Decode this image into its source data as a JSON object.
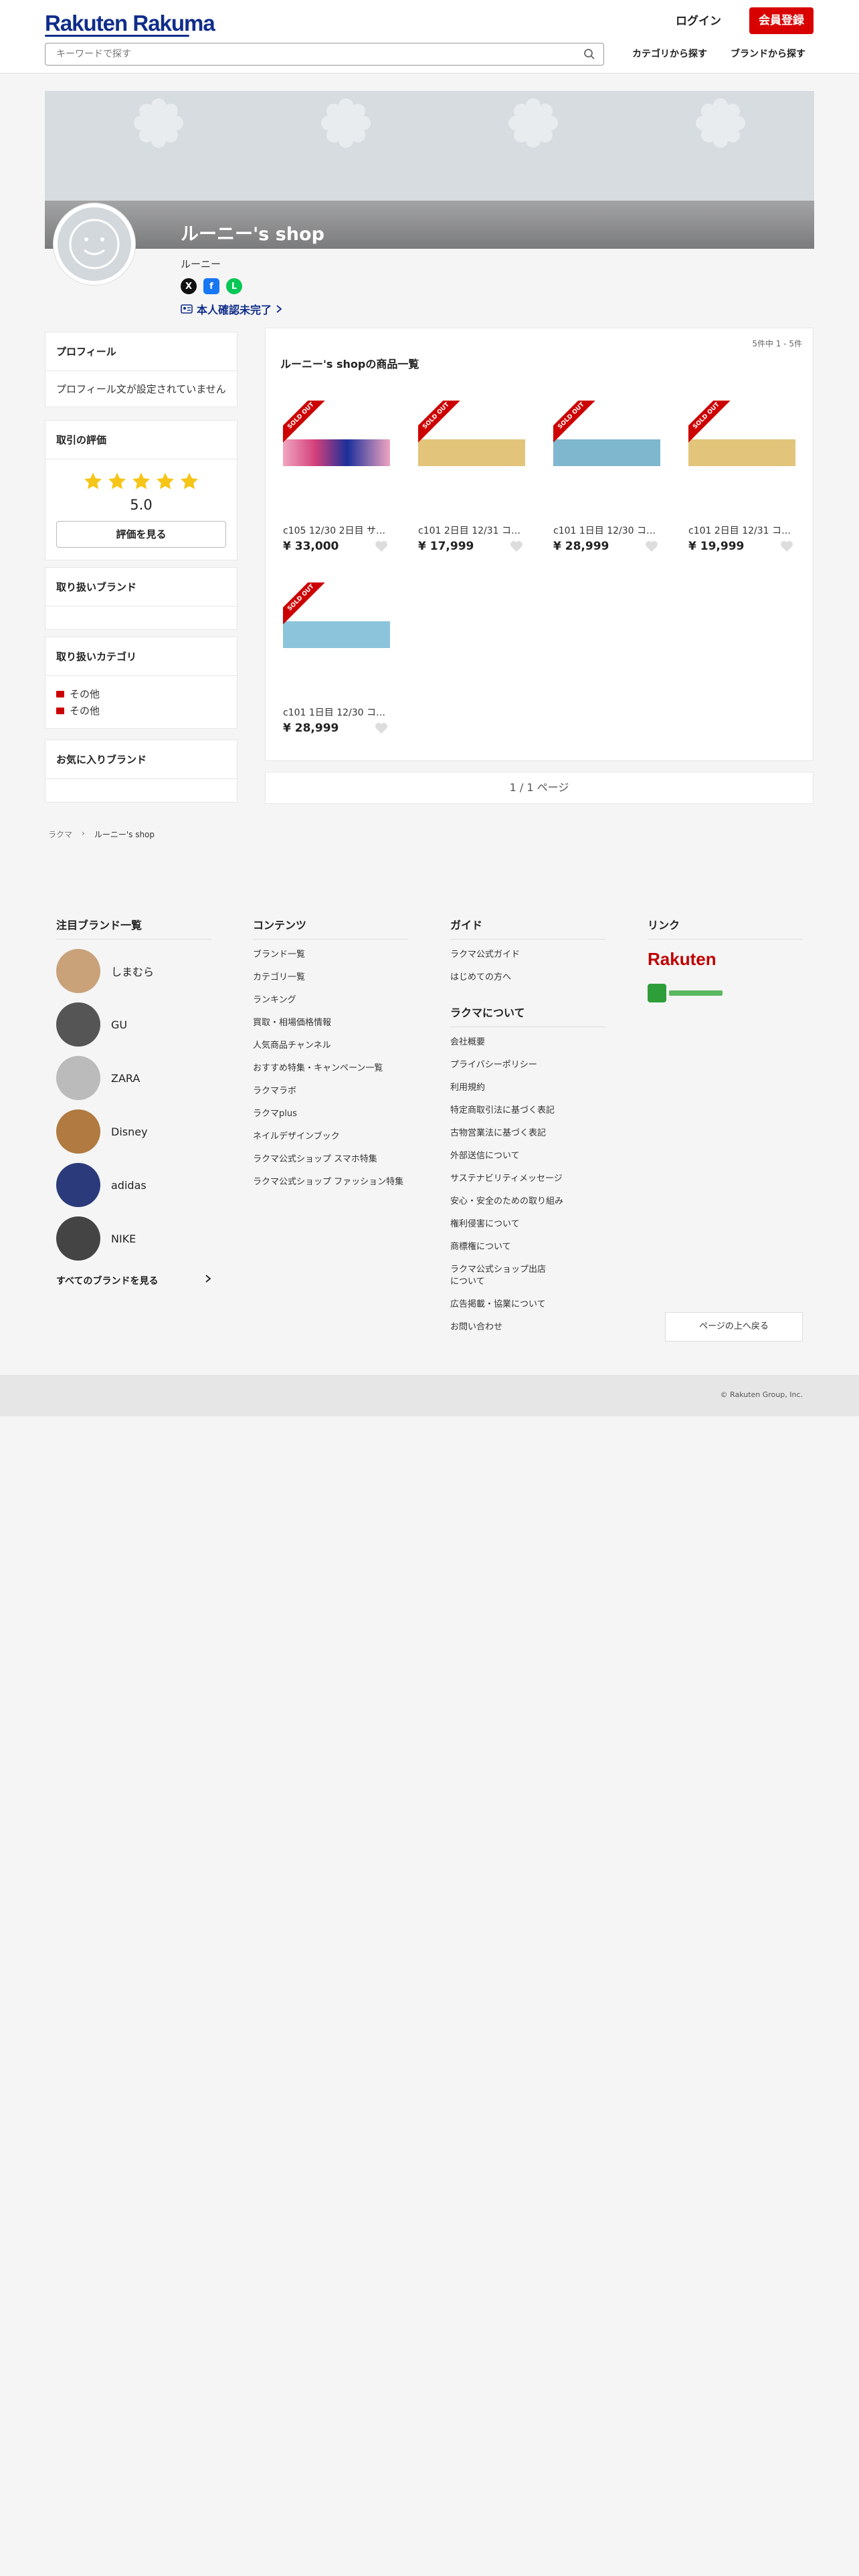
{
  "header": {
    "logo": "Rakuten Rakuma",
    "login": "ログイン",
    "signup": "会員登録",
    "search_placeholder": "キーワードで探す",
    "nav_category": "カテゴリから探す",
    "nav_brand": "ブランドから探す"
  },
  "shop": {
    "title": "ルーニー's shop",
    "username": "ルーニー",
    "verification": "本人確認未完了"
  },
  "sidebar": {
    "profile": {
      "title": "プロフィール",
      "text": "プロフィール文が設定されていません"
    },
    "rating": {
      "title": "取引の評価",
      "stars": 5,
      "score": "5.0",
      "button": "評価を見る"
    },
    "brands": {
      "title": "取り扱いブランド"
    },
    "categories": {
      "title": "取り扱いカテゴリ",
      "items": [
        "その他",
        "その他"
      ]
    },
    "favorite_brands": {
      "title": "お気に入りブランド"
    }
  },
  "listing": {
    "count": "5件中 1 - 5件",
    "title": "ルーニー's shopの商品一覧",
    "sold_label": "SOLD OUT",
    "items": [
      {
        "name": "c105 12/30 2日目 サ…",
        "price": "¥ 33,000",
        "ticket_color": "#d4407a"
      },
      {
        "name": "c101 2日目 12/31 コ…",
        "price": "¥ 17,999",
        "ticket_color": "#e2c47a"
      },
      {
        "name": "c101 1日目 12/30 コ…",
        "price": "¥ 28,999",
        "ticket_color": "#7fb7cf"
      },
      {
        "name": "c101 2日目 12/31 コ…",
        "price": "¥ 19,999",
        "ticket_color": "#e2c47a"
      },
      {
        "name": "c101 1日目 12/30 コ…",
        "price": "¥ 28,999",
        "ticket_color": "#8cc4dc"
      }
    ],
    "pager": "1 / 1 ページ"
  },
  "breadcrumb": {
    "home": "ラクマ",
    "current": "ルーニー's shop"
  },
  "footer": {
    "brands_title": "注目ブランド一覧",
    "brands": [
      "しまむら",
      "GU",
      "ZARA",
      "Disney",
      "adidas",
      "NIKE"
    ],
    "all_brands": "すべてのブランドを見る",
    "contents_title": "コンテンツ",
    "contents": [
      "ブランド一覧",
      "カテゴリ一覧",
      "ランキング",
      "買取・相場価格情報",
      "人気商品チャンネル",
      "おすすめ特集・キャンペーン一覧",
      "ラクマラボ",
      "ラクマplus",
      "ネイルデザインブック",
      "ラクマ公式ショップ スマホ特集",
      "ラクマ公式ショップ ファッション特集"
    ],
    "guide_title": "ガイド",
    "guide": [
      "ラクマ公式ガイド",
      "はじめての方へ"
    ],
    "about_title": "ラクマについて",
    "about": [
      "会社概要",
      "プライバシーポリシー",
      "利用規約",
      "特定商取引法に基づく表記",
      "古物営業法に基づく表記",
      "外部送信について",
      "サステナビリティメッセージ",
      "安心・安全のための取り組み",
      "権利侵害について",
      "商標権について",
      "ラクマ公式ショップ出店について",
      "広告掲載・協業について",
      "お問い合わせ"
    ],
    "links_title": "リンク",
    "rakuten_logo": "Rakuten",
    "back_to_top": "ページの上へ戻る",
    "copyright": "© Rakuten Group, Inc."
  }
}
